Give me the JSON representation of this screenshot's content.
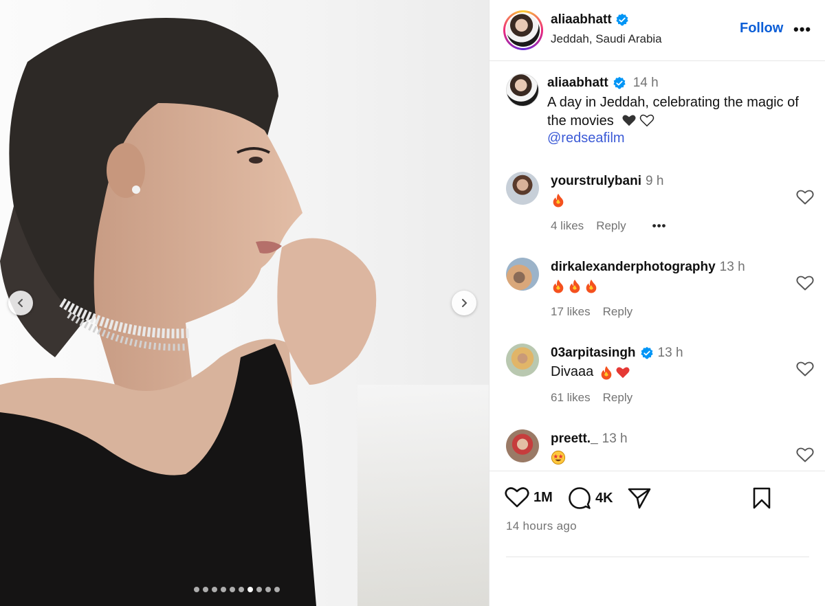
{
  "post": {
    "username": "aliaabhatt",
    "location": "Jeddah, Saudi Arabia",
    "follow_label": "Follow",
    "more_label": "•••"
  },
  "caption": {
    "username": "aliaabhatt",
    "time": "14 h",
    "text": "A day in Jeddah, celebrating the magic of the movies",
    "mention": "@redseafilm"
  },
  "comments": [
    {
      "username": "yourstrulybani",
      "time": "9 h",
      "emojis": [
        "fire"
      ],
      "text": "",
      "likes": "4 likes",
      "reply": "Reply",
      "verified": false,
      "show_more": true
    },
    {
      "username": "dirkalexanderphotography",
      "time": "13 h",
      "emojis": [
        "fire",
        "fire",
        "fire"
      ],
      "text": "",
      "likes": "17 likes",
      "reply": "Reply",
      "verified": false,
      "show_more": false
    },
    {
      "username": "03arpitasingh",
      "time": "13 h",
      "emojis": [
        "fire",
        "red-heart"
      ],
      "text": "Divaaa",
      "likes": "61 likes",
      "reply": "Reply",
      "verified": true,
      "show_more": false
    },
    {
      "username": "preett._",
      "time": "13 h",
      "emojis": [
        "star-struck"
      ],
      "text": "",
      "likes": "",
      "reply": "",
      "verified": false,
      "show_more": false
    }
  ],
  "actions": {
    "like_count": "1M",
    "comment_count": "4K",
    "posted_ago": "14 hours ago"
  },
  "carousel": {
    "total": 10,
    "active_index": 6
  },
  "colors": {
    "link_blue": "#0b5ed7",
    "mention_blue": "#3b5ad6",
    "verified_blue": "#0095f6",
    "muted_text": "#737373"
  }
}
